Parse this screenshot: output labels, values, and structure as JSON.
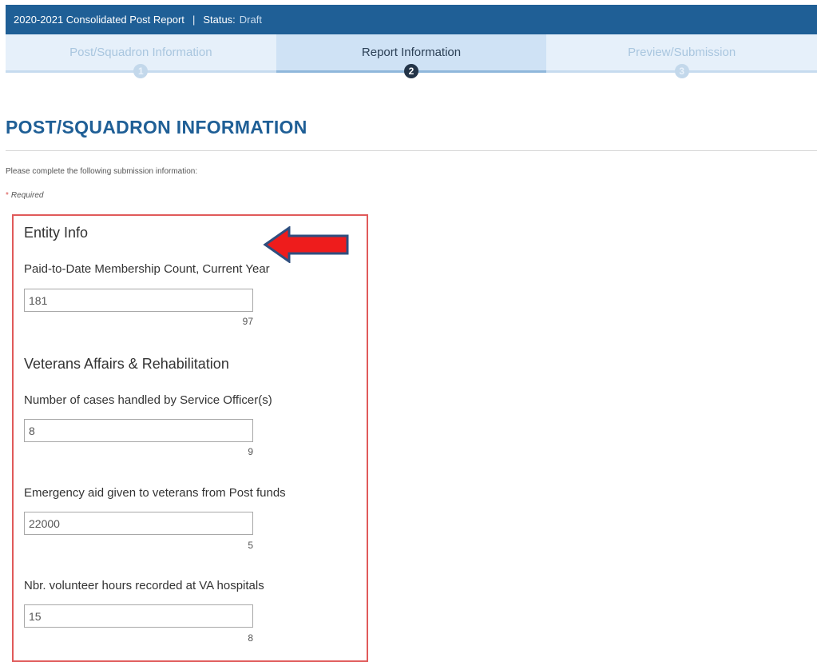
{
  "header": {
    "report_title": "2020-2021 Consolidated Post Report",
    "separator": "|",
    "status_label": "Status:",
    "status_value": "Draft"
  },
  "steps": [
    {
      "label": "Post/Squadron Information",
      "number": "1",
      "active": false
    },
    {
      "label": "Report Information",
      "number": "2",
      "active": true
    },
    {
      "label": "Preview/Submission",
      "number": "3",
      "active": false
    }
  ],
  "page": {
    "title": "POST/SQUADRON INFORMATION",
    "instructions": "Please complete the following submission information:",
    "required_star": "*",
    "required_label": "Required"
  },
  "sections": {
    "entity_info": {
      "heading": "Entity Info",
      "membership": {
        "label": "Paid-to-Date Membership Count, Current Year",
        "value": "181",
        "previous": "97"
      }
    },
    "veterans_affairs": {
      "heading": "Veterans Affairs & Rehabilitation",
      "cases": {
        "label": "Number of cases handled by Service Officer(s)",
        "value": "8",
        "previous": "9"
      },
      "emergency_aid": {
        "label": "Emergency aid given to veterans from Post funds",
        "value": "22000",
        "previous": "5"
      },
      "volunteer_hours": {
        "label": "Nbr. volunteer hours recorded at VA hospitals",
        "value": "15",
        "previous": "8"
      }
    }
  },
  "colors": {
    "header_bg": "#1f5f96",
    "highlight_border": "#e05a5a",
    "arrow_fill": "#ee1c1c",
    "arrow_outline": "#2f4f7f"
  }
}
